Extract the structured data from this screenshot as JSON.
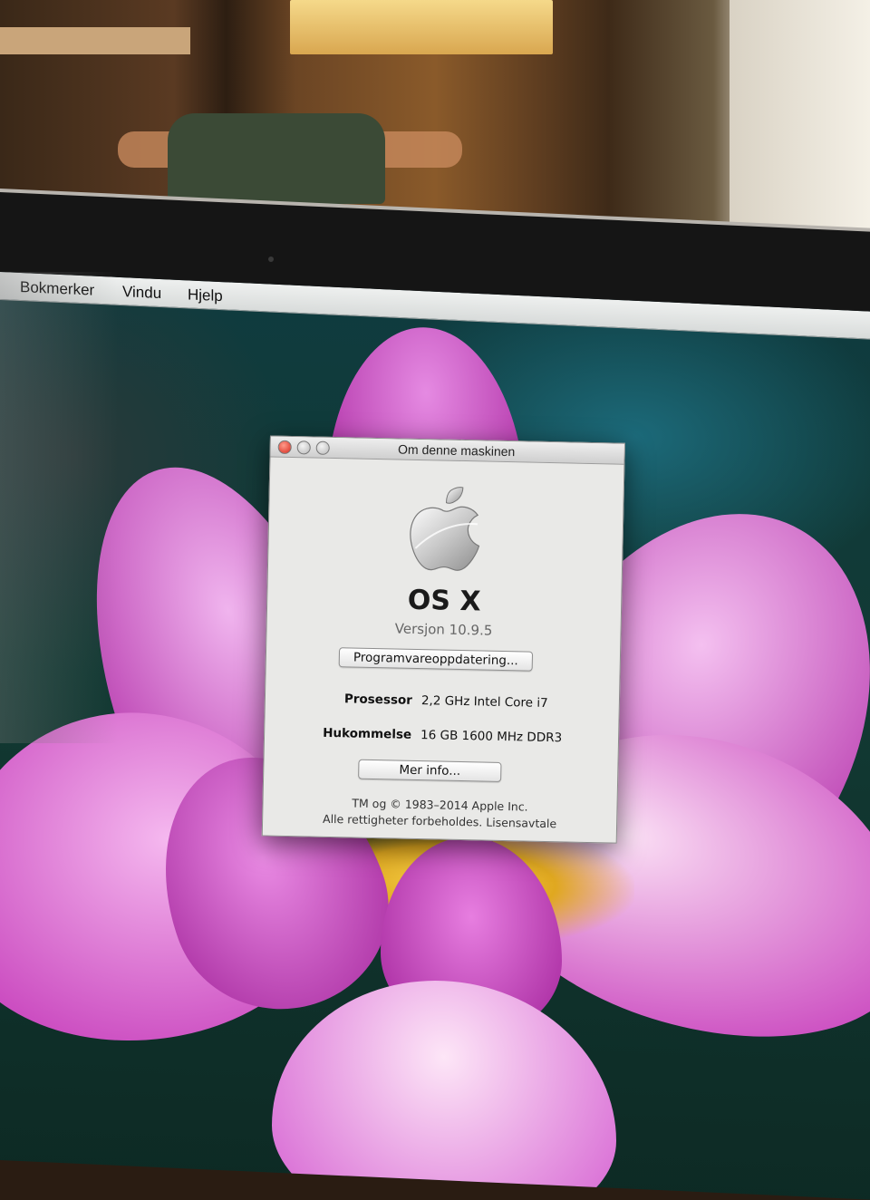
{
  "menubar": {
    "items": [
      "Bokmerker",
      "Vindu",
      "Hjelp"
    ]
  },
  "dialog": {
    "title": "Om denne maskinen",
    "os_name": "OS X",
    "version": "Versjon 10.9.5",
    "update_button": "Programvareoppdatering...",
    "processor_label": "Prosessor",
    "processor_value": "2,2 GHz Intel Core i7",
    "memory_label": "Hukommelse",
    "memory_value": "16 GB 1600 MHz  DDR3",
    "more_info_button": "Mer info...",
    "copyright": "TM og © 1983–2014 Apple Inc.",
    "rights_prefix": "Alle rettigheter forbeholdes.",
    "license_link": "Lisensavtale"
  },
  "colors": {
    "close_button": "#d62a1e",
    "wallpaper_petal": "#c02fb4"
  }
}
